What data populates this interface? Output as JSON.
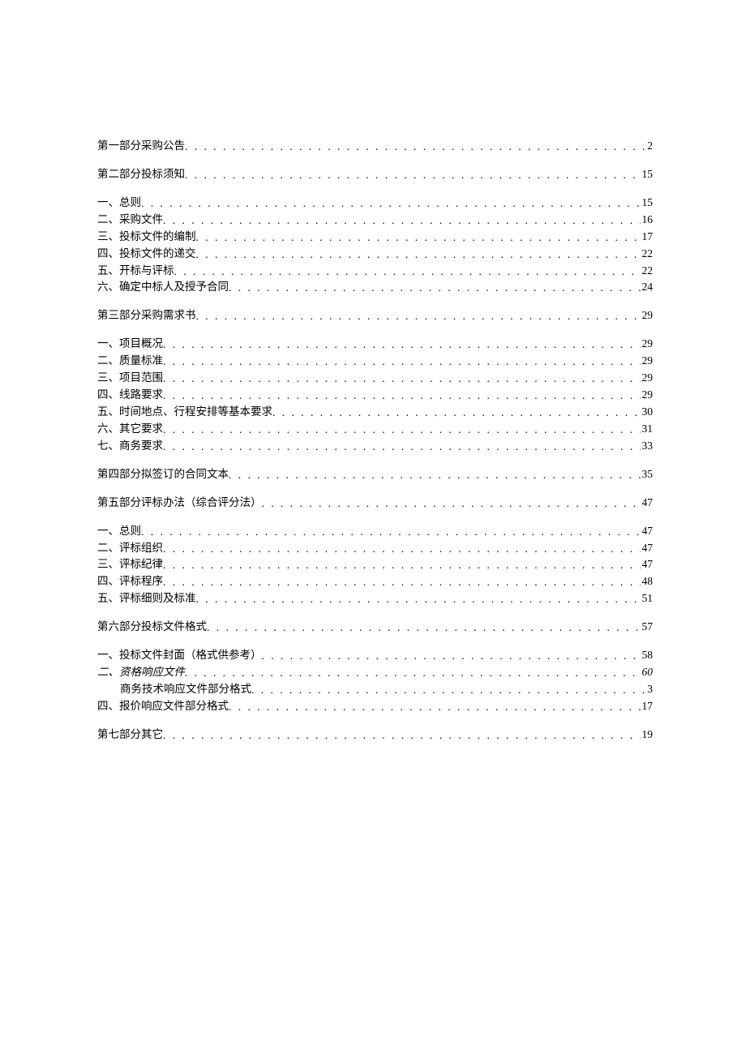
{
  "toc": {
    "groups": [
      {
        "entries": [
          {
            "text": "第一部分采购公告",
            "page": "2",
            "indent": false,
            "italic": false
          }
        ]
      },
      {
        "entries": [
          {
            "text": "第二部分投标须知",
            "page": "15",
            "indent": false,
            "italic": false
          }
        ]
      },
      {
        "entries": [
          {
            "text": "一、总则",
            "page": "15",
            "indent": false,
            "italic": false
          },
          {
            "text": "二、采购文件",
            "page": "16",
            "indent": false,
            "italic": false
          },
          {
            "text": "三、投标文件的编制",
            "page": "17",
            "indent": false,
            "italic": false
          },
          {
            "text": "四、投标文件的递交",
            "page": "22",
            "indent": false,
            "italic": false
          },
          {
            "text": "五、开标与评标",
            "page": "22",
            "indent": false,
            "italic": false
          },
          {
            "text": "六、确定中标人及授予合同",
            "page": "24",
            "indent": false,
            "italic": false
          }
        ]
      },
      {
        "entries": [
          {
            "text": "第三部分采购需求书",
            "page": "29",
            "indent": false,
            "italic": false
          }
        ]
      },
      {
        "entries": [
          {
            "text": "一、项目概况",
            "page": "29",
            "indent": false,
            "italic": false
          },
          {
            "text": "二、质量标准",
            "page": "29",
            "indent": false,
            "italic": false
          },
          {
            "text": "三、项目范围",
            "page": "29",
            "indent": false,
            "italic": false
          },
          {
            "text": "四、线路要求",
            "page": "29",
            "indent": false,
            "italic": false
          },
          {
            "text": "五、时间地点、行程安排等基本要求",
            "page": "30",
            "indent": false,
            "italic": false
          },
          {
            "text": "六、其它要求",
            "page": "31",
            "indent": false,
            "italic": false
          },
          {
            "text": "七、商务要求",
            "page": "33",
            "indent": false,
            "italic": false
          }
        ]
      },
      {
        "entries": [
          {
            "text": "第四部分拟签订的合同文本",
            "page": "35",
            "indent": false,
            "italic": false
          }
        ]
      },
      {
        "entries": [
          {
            "text": "第五部分评标办法（综合评分法）",
            "page": "47",
            "indent": false,
            "italic": false
          }
        ]
      },
      {
        "entries": [
          {
            "text": "一、总则",
            "page": "47",
            "indent": false,
            "italic": false
          },
          {
            "text": "二、评标组织",
            "page": "47",
            "indent": false,
            "italic": false
          },
          {
            "text": "三、评标纪律",
            "page": "47",
            "indent": false,
            "italic": false
          },
          {
            "text": "四、评标程序",
            "page": "48",
            "indent": false,
            "italic": false
          },
          {
            "text": "五、评标细则及标准",
            "page": "51",
            "indent": false,
            "italic": false
          }
        ]
      },
      {
        "entries": [
          {
            "text": "第六部分投标文件格式",
            "page": "57",
            "indent": false,
            "italic": false
          }
        ]
      },
      {
        "entries": [
          {
            "text": "一、投标文件封面（格式供参考）",
            "page": "58",
            "indent": false,
            "italic": false
          },
          {
            "text": "二、资格响应文件",
            "page": "60",
            "indent": false,
            "italic": true
          },
          {
            "text": "商务技术响应文件部分格式",
            "page": "3",
            "indent": true,
            "italic": false
          },
          {
            "text": "四、报价响应文件部分格式",
            "page": "17",
            "indent": false,
            "italic": false
          }
        ]
      },
      {
        "entries": [
          {
            "text": "第七部分其它",
            "page": "19",
            "indent": false,
            "italic": false
          }
        ]
      }
    ]
  },
  "dots": ". . . . . . . . . . . . . . . . . . . . . . . . . . . . . . . . . . . . . . . . . . . . . . . . . . . . . . . . . . . . . . . . . . . . . . . . . . . . . . . . . . . . . . . . . . . . . . . . . . . . . . . . . . . . . . . . . . . . . . . ."
}
